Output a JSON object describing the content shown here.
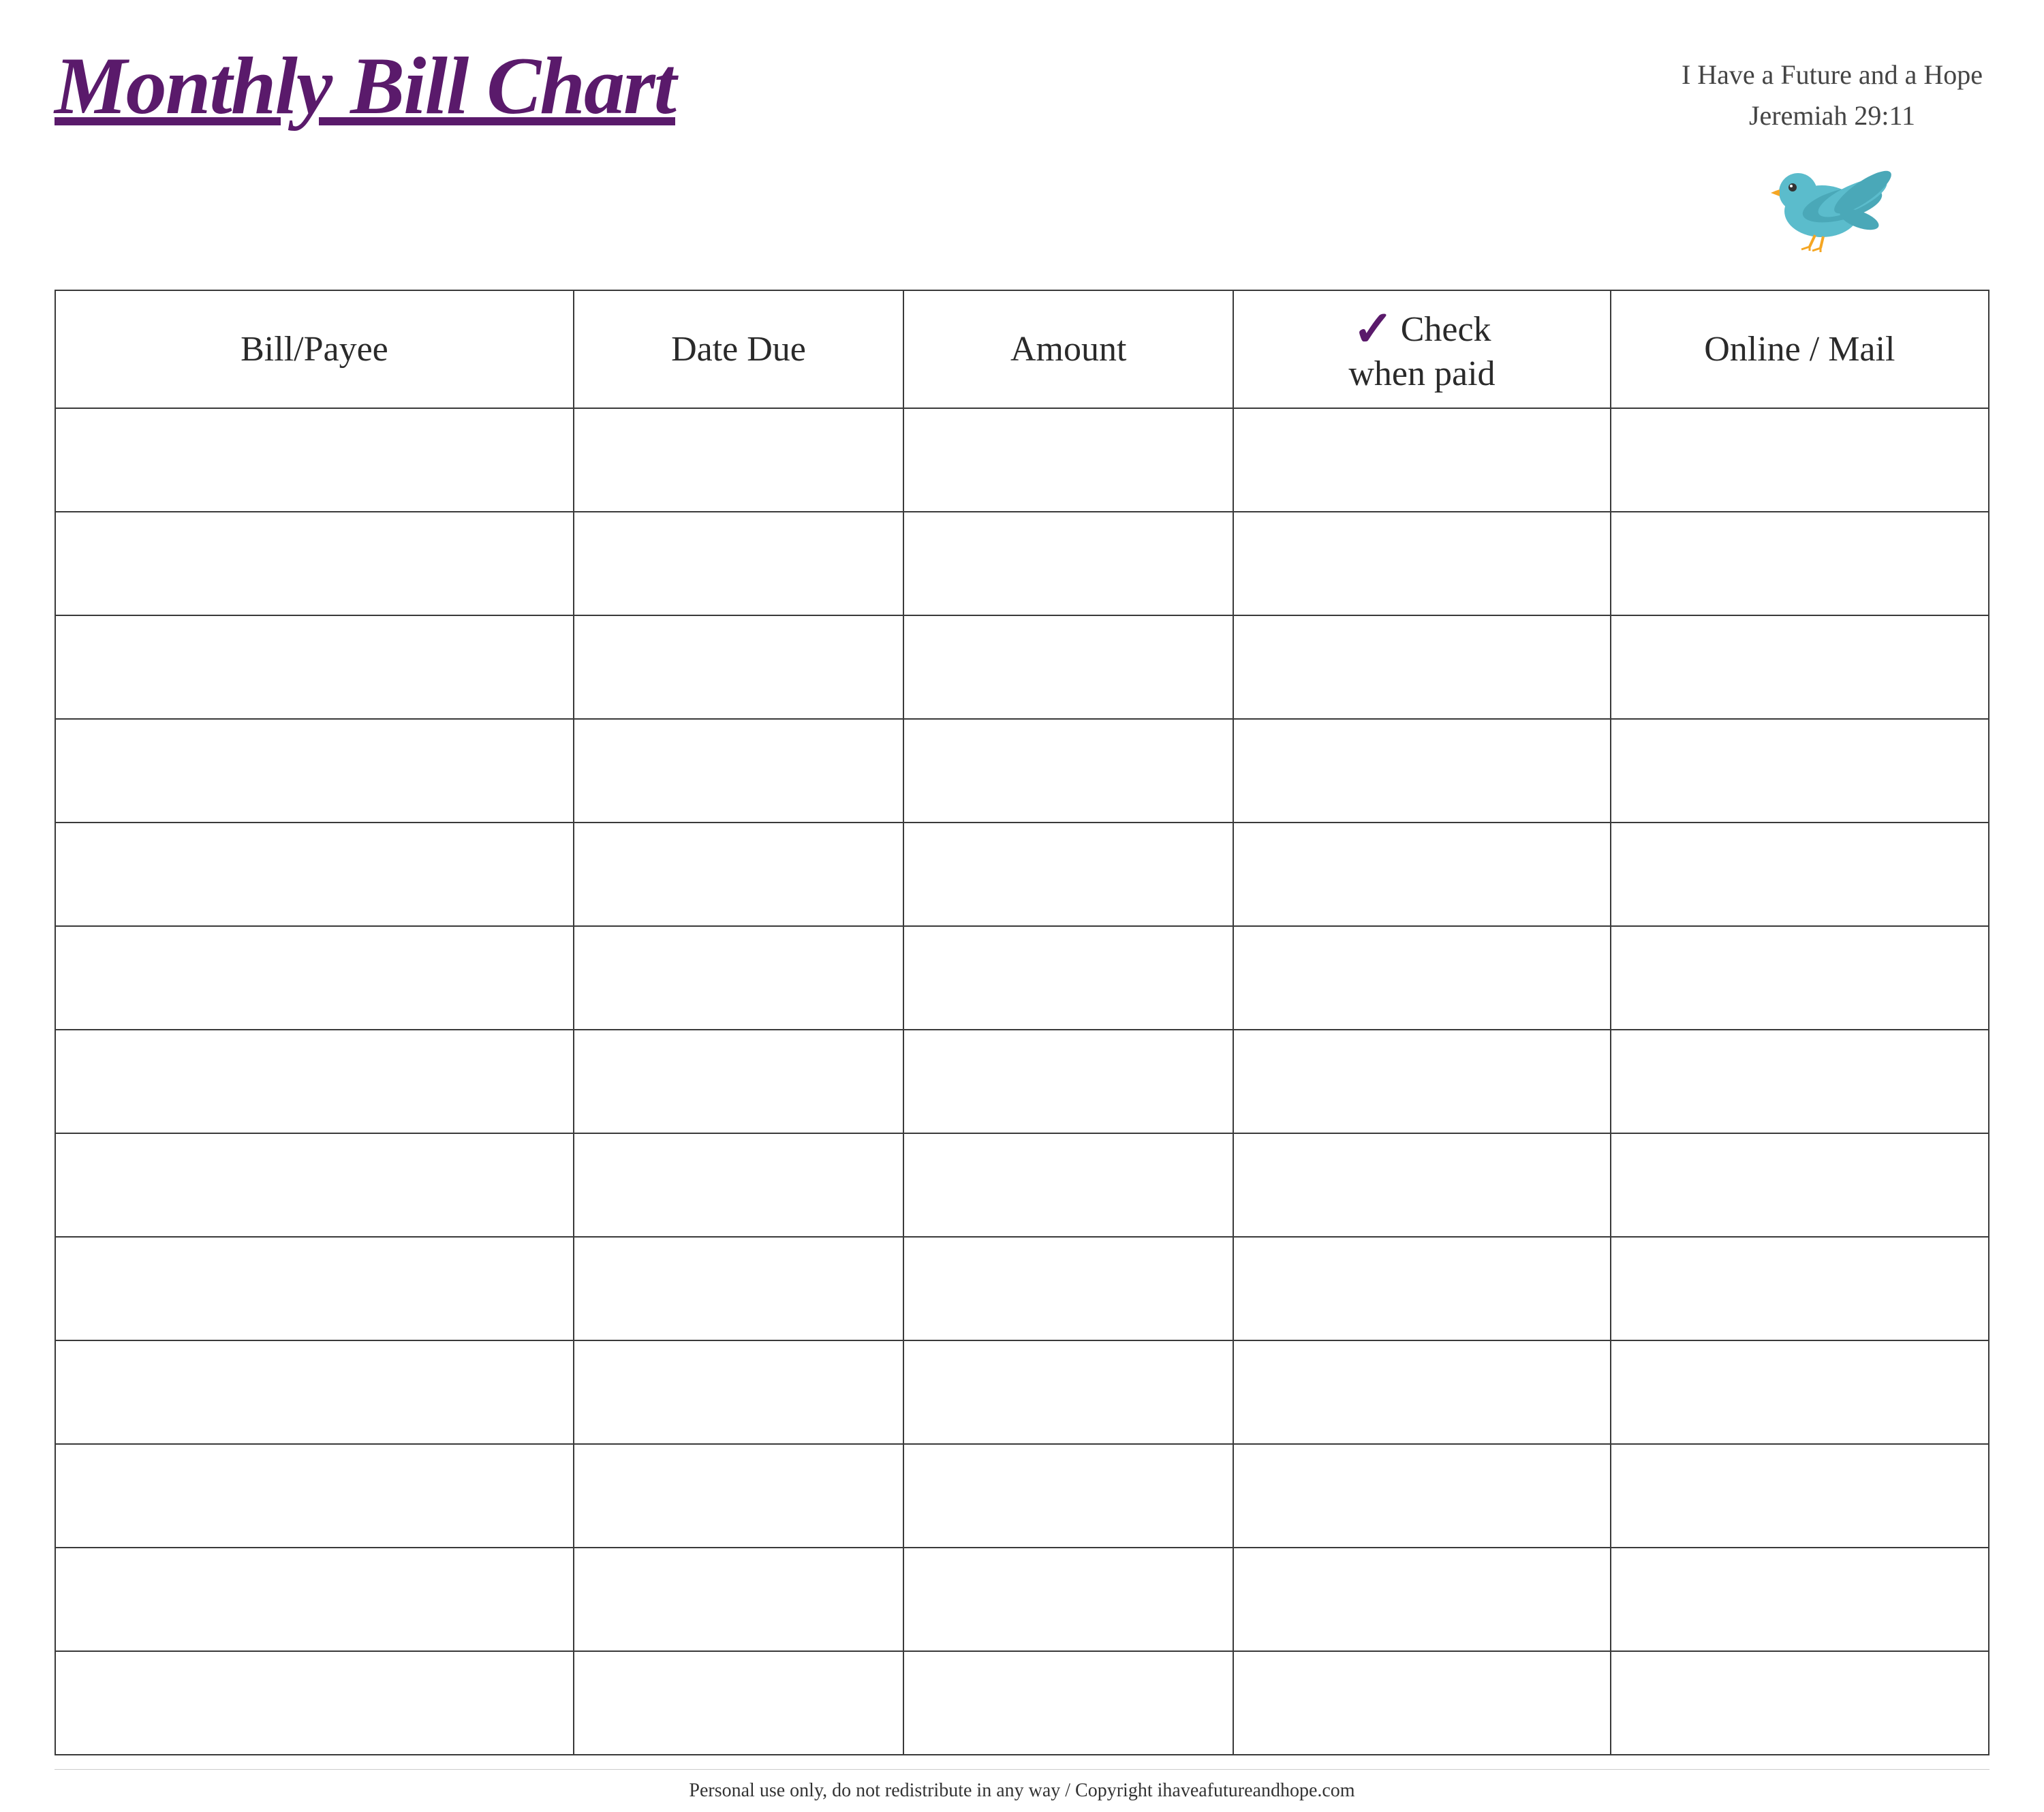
{
  "header": {
    "title": "Monthly Bill Chart",
    "scripture_line1": "I Have a Future and a Hope",
    "scripture_line2": "Jeremiah 29:11"
  },
  "table": {
    "columns": [
      {
        "id": "bill-payee",
        "label": "Bill/Payee"
      },
      {
        "id": "date-due",
        "label": "Date Due"
      },
      {
        "id": "amount",
        "label": "Amount"
      },
      {
        "id": "check-when-paid",
        "label_top": "Check",
        "label_bottom": "when paid",
        "has_checkmark": true
      },
      {
        "id": "online-mail",
        "label": "Online / Mail"
      }
    ],
    "row_count": 13
  },
  "footer": {
    "text": "Personal use only, do not redistribute in any way / Copyright ihaveafutureandhope.com"
  },
  "colors": {
    "title": "#5a1a6b",
    "checkmark": "#5a1a6b",
    "table_border": "#3a3a3a",
    "text": "#2a2a2a",
    "scripture": "#444444"
  }
}
